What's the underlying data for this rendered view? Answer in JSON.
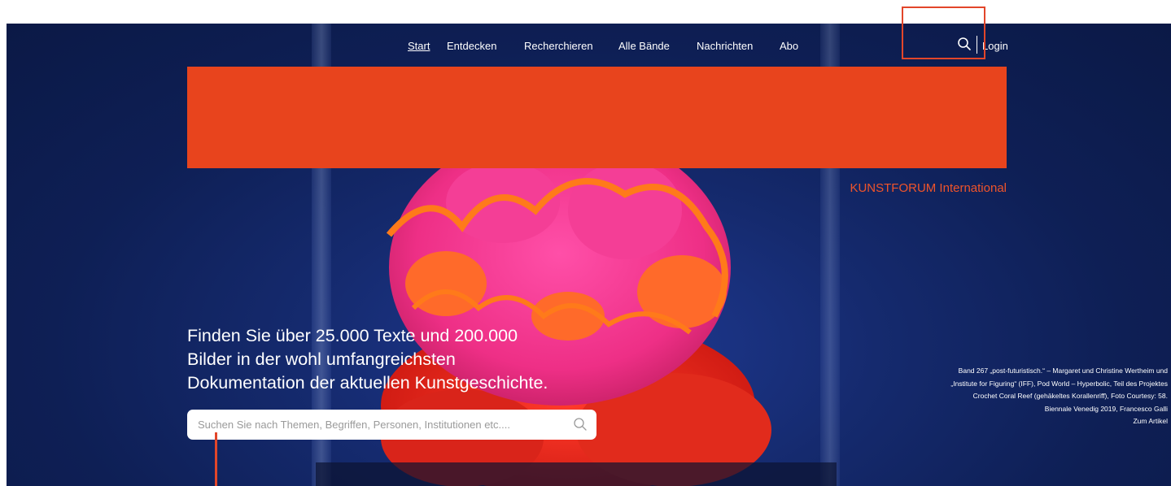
{
  "nav": {
    "items": [
      {
        "label": "Start",
        "active": true
      },
      {
        "label": "Entdecken"
      },
      {
        "label": "Recherchieren"
      },
      {
        "label": "Alle Bände"
      },
      {
        "label": "Nachrichten"
      },
      {
        "label": "Abo"
      }
    ],
    "login_label": "Login"
  },
  "brand": {
    "name": "KUNSTFORUM International",
    "banner_color": "#e8441d",
    "accent_color": "#f0542a"
  },
  "hero": {
    "headline_lines": [
      "Finden Sie über 25.000 Texte und 200.000",
      "Bilder in der wohl umfangreichsten",
      "Dokumentation der aktuellen Kunstgeschichte."
    ],
    "search_placeholder": "Suchen Sie nach Themen, Begriffen, Personen, Institutionen etc....",
    "search_value": ""
  },
  "caption": {
    "text": "Band 267 „post-futuristisch.“ – Margaret und Christine Wertheim und „Institute for Figuring“ (IFF), Pod World – Hyperbolic, Teil des Projektes Crochet Coral Reef (gehäkeltes Korallenriff), Foto Courtesy: 58. Biennale Venedig 2019, Francesco Galli",
    "link_label": "Zum Artikel"
  },
  "icons": {
    "search": "search-icon"
  }
}
